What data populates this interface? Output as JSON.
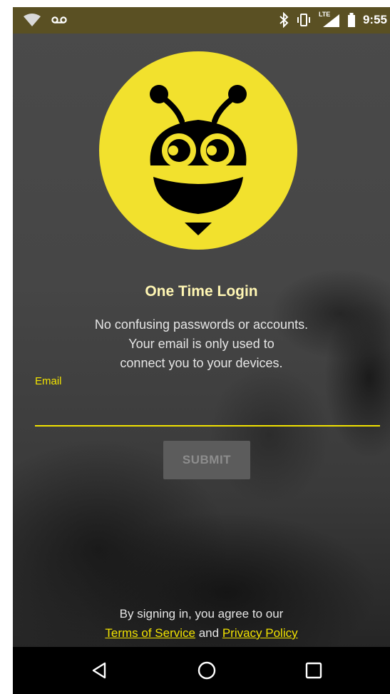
{
  "status_bar": {
    "time": "9:55",
    "icons": [
      "wifi-icon",
      "voicemail-icon",
      "bluetooth-icon",
      "vibrate-icon",
      "lte-signal-icon",
      "battery-icon"
    ],
    "network_label": "LTE"
  },
  "logo": {
    "icon": "bee-logo-icon",
    "circle_color": "#f2e12d"
  },
  "login": {
    "title": "One Time Login",
    "subtitle_lines": [
      "No confusing passwords or accounts.",
      "Your email is only used to",
      "connect you to your devices."
    ],
    "email_label": "Email",
    "email_value": "",
    "submit_label": "SUBMIT"
  },
  "legal": {
    "prefix": "By signing in, you agree to our",
    "terms_link": "Terms of Service",
    "conjunction": "and",
    "privacy_link": "Privacy Policy"
  },
  "nav_bar": {
    "buttons": [
      "back-icon",
      "home-icon",
      "recents-icon"
    ]
  },
  "colors": {
    "accent": "#f2e300",
    "title": "#fff6b3",
    "status_bar": "#5a5023"
  }
}
